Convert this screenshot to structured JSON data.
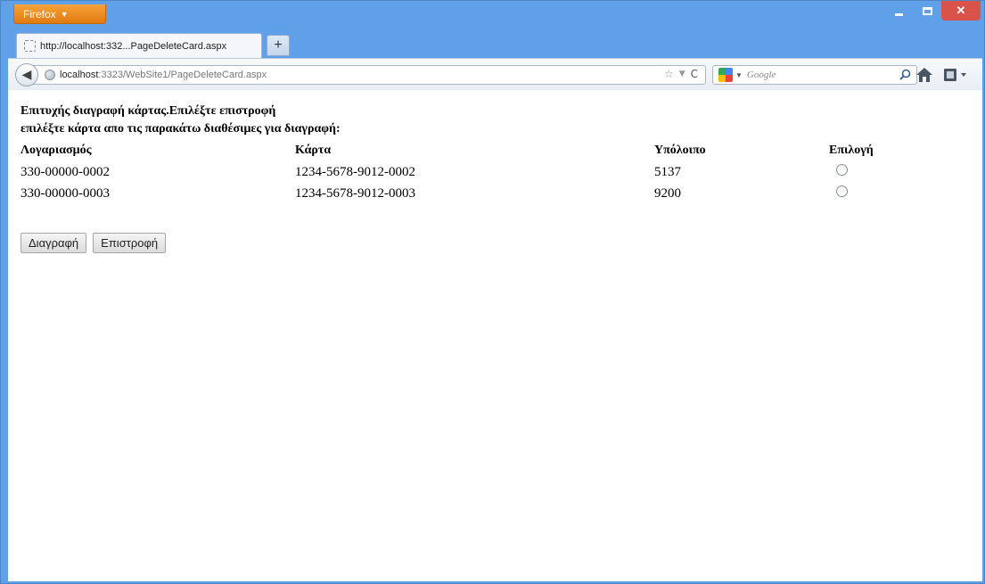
{
  "browser": {
    "app_button_label": "Firefox",
    "tab_title": "http://localhost:332...PageDeleteCard.aspx",
    "new_tab_symbol": "+",
    "url_host": "localhost",
    "url_rest": ":3323/WebSite1/PageDeleteCard.aspx",
    "search_placeholder": "Google",
    "icons": [
      "back-arrow-icon",
      "globe-icon",
      "bookmark-star-icon",
      "dropdown-icon",
      "reload-icon",
      "google-logo-icon",
      "search-icon",
      "home-icon",
      "addon-icon"
    ]
  },
  "page": {
    "success_message": "Επιτυχής διαγραφή κάρτας.Επιλέξτε επιστροφή",
    "instruction": "επιλέξτε κάρτα απο τις παρακάτω διαθέσιμες για διαγραφή:",
    "table": {
      "headers": [
        "Λογαριασμός",
        "Κάρτα",
        "Υπόλοιπο",
        "Επιλογή"
      ],
      "rows": [
        {
          "account": "330-00000-0002",
          "card": "1234-5678-9012-0002",
          "balance": "5137"
        },
        {
          "account": "330-00000-0003",
          "card": "1234-5678-9012-0003",
          "balance": "9200"
        }
      ]
    },
    "buttons": {
      "delete": "Διαγραφή",
      "back": "Επιστροφή"
    }
  }
}
